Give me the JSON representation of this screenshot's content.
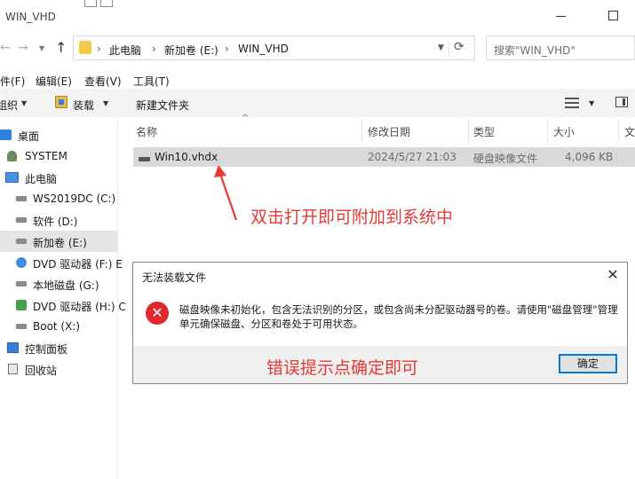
{
  "window": {
    "title": "WIN_VHD"
  },
  "address": {
    "crumbs": [
      "此电脑",
      "新加卷 (E:)",
      "WIN_VHD"
    ],
    "separator": "›"
  },
  "search": {
    "placeholder": "搜索\"WIN_VHD\""
  },
  "menu": {
    "items": [
      "件(F)",
      "编辑(E)",
      "查看(V)",
      "工具(T)"
    ]
  },
  "toolbar": {
    "organize": "组织",
    "mount": "装载",
    "new_folder": "新建文件夹"
  },
  "nav": {
    "items": [
      {
        "label": "桌面",
        "icon": "desktop-icon"
      },
      {
        "label": "SYSTEM",
        "icon": "user-icon"
      },
      {
        "label": "此电脑",
        "icon": "computer-icon"
      },
      {
        "label": "WS2019DC (C:)",
        "icon": "drive-icon"
      },
      {
        "label": "软件 (D:)",
        "icon": "drive-icon"
      },
      {
        "label": "新加卷 (E:)",
        "icon": "drive-icon"
      },
      {
        "label": "DVD 驱动器 (F:) E",
        "icon": "dvd-icon"
      },
      {
        "label": "本地磁盘 (G:)",
        "icon": "drive-icon"
      },
      {
        "label": "DVD 驱动器 (H:) C",
        "icon": "dvd-icon"
      },
      {
        "label": "Boot (X:)",
        "icon": "drive-icon"
      },
      {
        "label": "控制面板",
        "icon": "control-panel-icon"
      },
      {
        "label": "回收站",
        "icon": "recycle-bin-icon"
      }
    ],
    "selected_index": 5
  },
  "columns": {
    "name": "名称",
    "date": "修改日期",
    "type": "类型",
    "size": "大小",
    "extra": "文"
  },
  "file": {
    "name": "Win10.vhdx",
    "date": "2024/5/27 21:03",
    "type": "硬盘映像文件",
    "size": "4,096 KB"
  },
  "annotations": {
    "double_click": "双击打开即可附加到系统中",
    "confirm": "错误提示点确定即可",
    "color": "#e53935"
  },
  "dialog": {
    "title": "无法装载文件",
    "message": "磁盘映像未初始化，包含无法识别的分区，或包含尚未分配驱动器号的卷。请使用\"磁盘管理\"管理单元确保磁盘、分区和卷处于可用状态。",
    "ok": "确定",
    "close_glyph": "✕",
    "error_glyph": "✕"
  },
  "glyphs": {
    "back": "←",
    "forward": "→",
    "dropdown": "⌄",
    "up": "↑",
    "refresh": "⟳",
    "caret": "▼",
    "sort_up": "^"
  },
  "colors": {
    "selected": "#cce8ff",
    "accent": "#0078d7",
    "error": "#e0292e"
  }
}
